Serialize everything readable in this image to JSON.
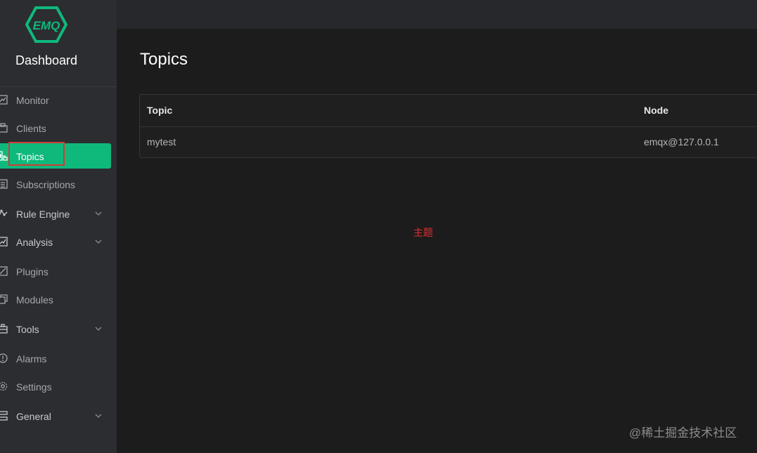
{
  "sidebar": {
    "logo_text": "EMQ",
    "brand": "Dashboard",
    "items": [
      {
        "label": "Monitor",
        "icon": "monitor-icon"
      },
      {
        "label": "Clients",
        "icon": "clients-icon"
      },
      {
        "label": "Topics",
        "icon": "topics-icon",
        "active": true
      },
      {
        "label": "Subscriptions",
        "icon": "subscriptions-icon"
      },
      {
        "label": "Rule Engine",
        "icon": "rule-engine-icon",
        "expandable": true
      },
      {
        "label": "Analysis",
        "icon": "analysis-icon",
        "expandable": true
      },
      {
        "label": "Plugins",
        "icon": "plugins-icon"
      },
      {
        "label": "Modules",
        "icon": "modules-icon"
      },
      {
        "label": "Tools",
        "icon": "tools-icon",
        "expandable": true
      },
      {
        "label": "Alarms",
        "icon": "alarms-icon"
      },
      {
        "label": "Settings",
        "icon": "settings-icon"
      },
      {
        "label": "General",
        "icon": "general-icon",
        "expandable": true
      }
    ]
  },
  "main": {
    "title": "Topics",
    "table": {
      "columns": [
        "Topic",
        "Node"
      ],
      "rows": [
        [
          "mytest",
          "emqx@127.0.0.1"
        ]
      ]
    }
  },
  "annotation": "主题",
  "watermark": "@稀土掘金技术社区",
  "colors": {
    "accent": "#0fb97c",
    "sidebar_bg": "#2b2d30",
    "main_bg": "#1c1c1c",
    "highlight": "#d33a3a"
  }
}
